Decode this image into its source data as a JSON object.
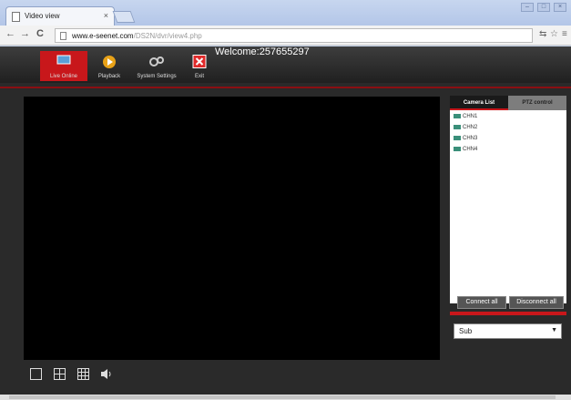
{
  "browser": {
    "tab_title": "Video view",
    "tab_close": "×",
    "url_host": "www.e-seenet.com",
    "url_path": "/DS2N/dvr/view4.php",
    "nav_back": "←",
    "nav_forward": "→",
    "nav_reload": "C"
  },
  "header": {
    "welcome": "Welcome:257655297",
    "nav": [
      {
        "label": "Live Online",
        "icon": "monitor-icon",
        "active": true
      },
      {
        "label": "Playback",
        "icon": "play-icon"
      },
      {
        "label": "System Settings",
        "icon": "gears-icon"
      },
      {
        "label": "Exit",
        "icon": "close-icon"
      }
    ]
  },
  "panel": {
    "tabs": [
      "Camera List",
      "PTZ control"
    ],
    "cameras": [
      "CHN1",
      "CHN2",
      "CHN3",
      "CHN4"
    ],
    "connect_all": "Connect all",
    "disconnect_all": "Disconnect all",
    "stream_select": "Sub"
  },
  "colors": {
    "accent": "#c8171b",
    "camera_icon": "#3a8f7a"
  }
}
